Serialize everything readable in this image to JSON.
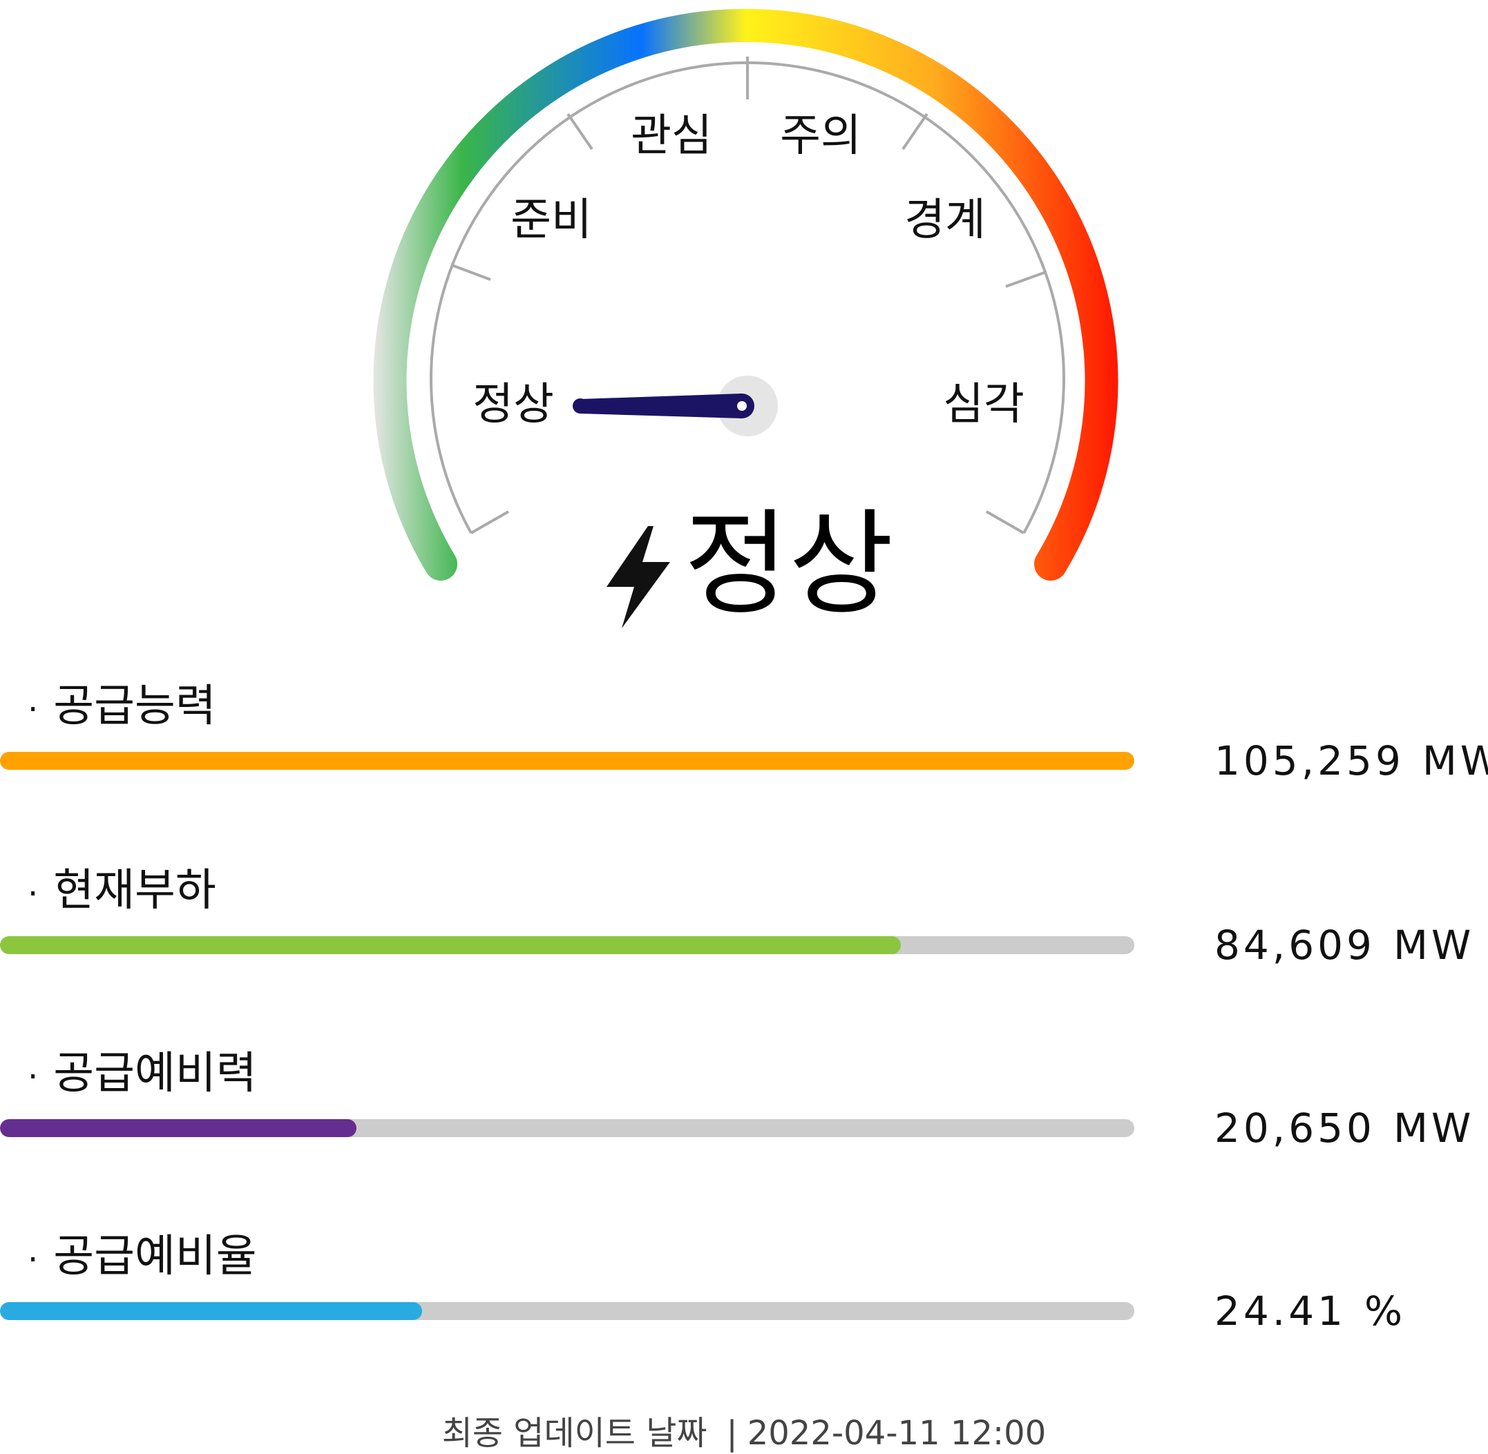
{
  "gauge": {
    "levels": [
      "정상",
      "준비",
      "관심",
      "주의",
      "경계",
      "심각"
    ],
    "current_level": "정상",
    "colors": [
      "#e6e6e6",
      "#3ab54a",
      "#0872ff",
      "#fff21a",
      "#ffac1e",
      "#ff1600"
    ]
  },
  "status": {
    "icon": "lightning-bolt-icon",
    "text": "정상"
  },
  "metrics": [
    {
      "label": "공급능력",
      "value": "105,259",
      "unit": "MW",
      "fill": 1.0,
      "color": "#ffa200"
    },
    {
      "label": "현재부하",
      "value": "84,609",
      "unit": "MW",
      "fill": 0.794,
      "color": "#8cc63f"
    },
    {
      "label": "공급예비력",
      "value": "20,650",
      "unit": "MW",
      "fill": 0.314,
      "color": "#662d91"
    },
    {
      "label": "공급예비율",
      "value": "24.41",
      "unit": "%",
      "fill": 0.372,
      "color": "#29abe2"
    }
  ],
  "bullet": "·",
  "track_color": "#cccccc",
  "footer": {
    "label": "최종 업데이트 날짜",
    "separator": "|",
    "datetime": "2022-04-11 12:00"
  }
}
